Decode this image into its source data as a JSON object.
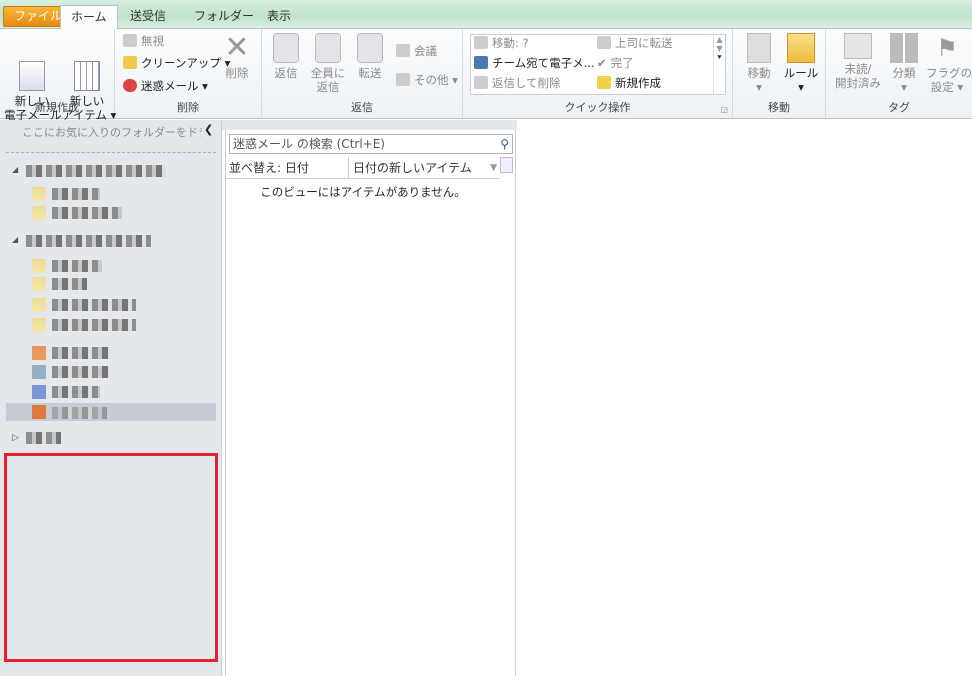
{
  "tabs": [
    {
      "label": "ファイル"
    },
    {
      "label": "ホーム"
    },
    {
      "label": "送受信"
    },
    {
      "label": "フォルダー"
    },
    {
      "label": "表示"
    }
  ],
  "ribbon": {
    "new": {
      "new_mail": "新しい\n電子メール",
      "new_items": "新しい\nアイテム ▾",
      "label": "新規作成"
    },
    "delete": {
      "ignore": "無視",
      "cleanup": "クリーンアップ ▾",
      "junk": "迷惑メール ▾",
      "delete": "削除",
      "label": "削除"
    },
    "respond": {
      "reply": "返信",
      "reply_all": "全員に\n返信",
      "forward": "転送",
      "meeting": "会議",
      "more": "その他 ▾",
      "label": "返信"
    },
    "quick": {
      "move": "移動: ?",
      "team": "チーム宛て電子メ...",
      "reply_delete": "返信して削除",
      "to_manager": "上司に転送",
      "done": "完了",
      "create_new": "新規作成",
      "label": "クイック操作"
    },
    "move": {
      "move": "移動",
      "rules": "ルール",
      "label": "移動"
    },
    "tags": {
      "unread": "未読/\n開封済み",
      "categorize": "分類",
      "flag": "フラグの\n設定 ▾",
      "label": "タグ"
    }
  },
  "nav": {
    "favorites_hint": "ここにお気に入りのフォルダーをドラッグし"
  },
  "list": {
    "search_placeholder": "迷惑メール の検索 (Ctrl+E)",
    "sort_by": "並べ替え: 日付",
    "order": "日付の新しいアイテム",
    "empty_message": "このビューにはアイテムがありません。"
  },
  "colors": {
    "highlight": "#e5222b",
    "file_tab": "#f0a22a"
  }
}
